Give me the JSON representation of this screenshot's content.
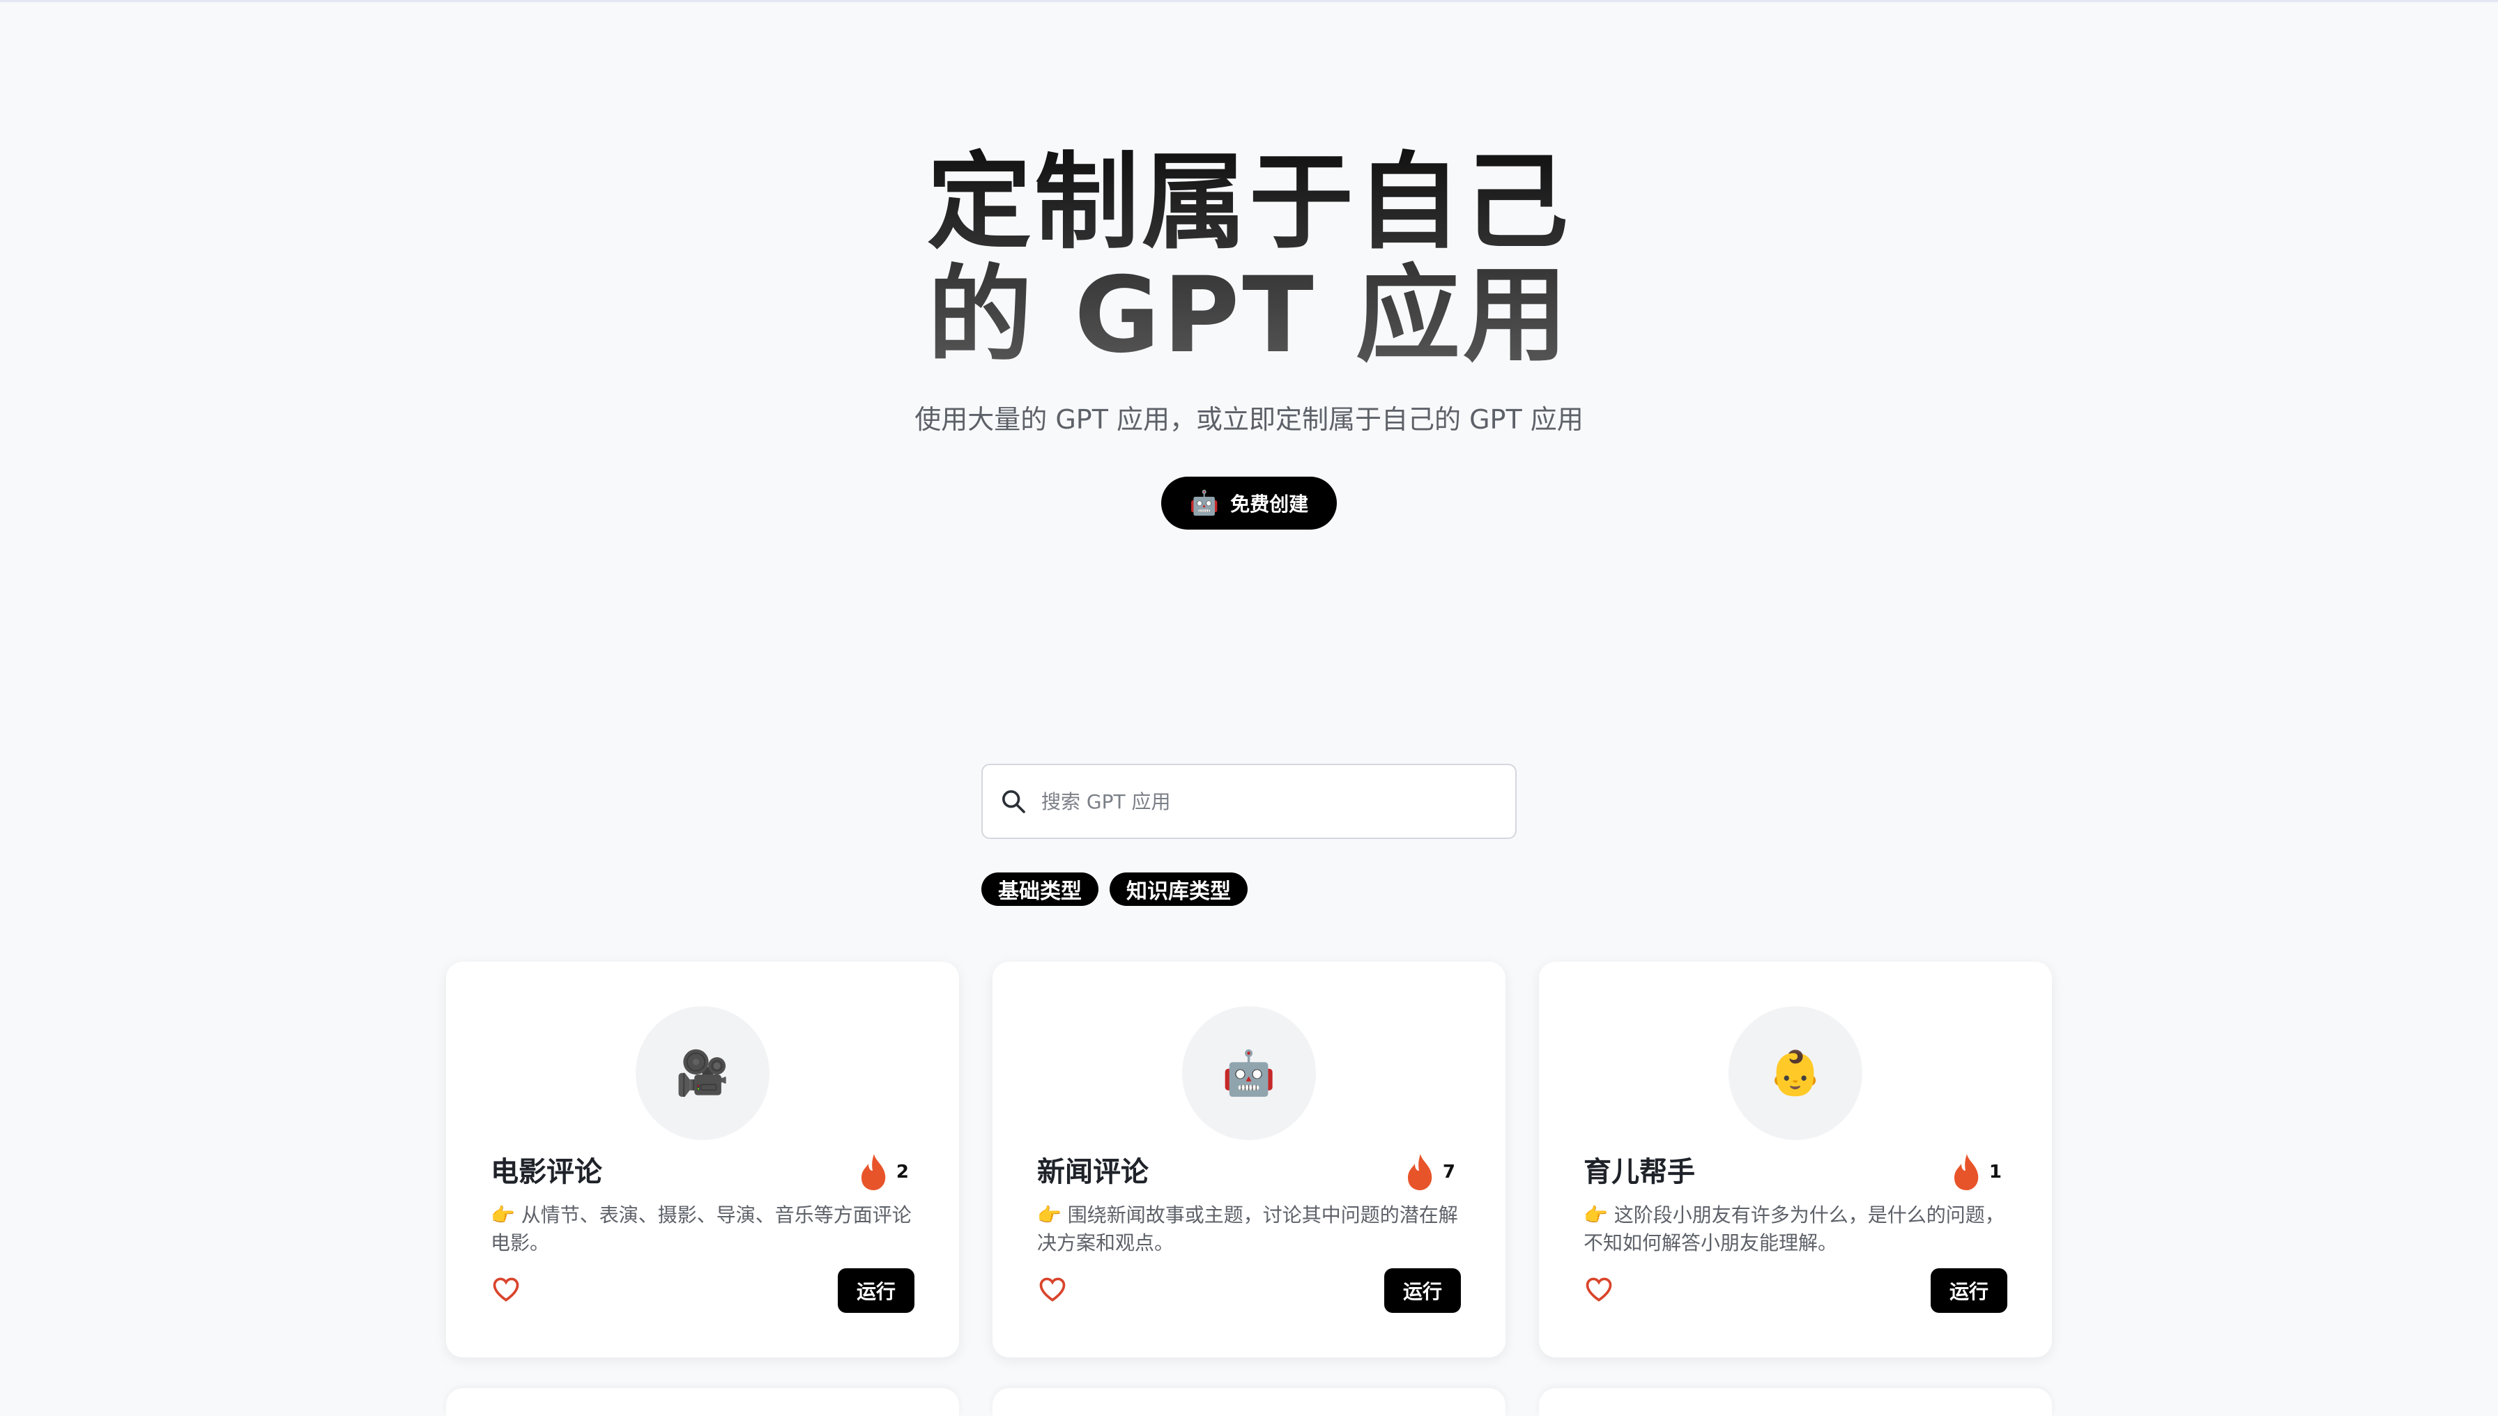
{
  "hero": {
    "title_line1": "定制属于自己",
    "title_line2": "的 GPT 应用",
    "subtitle": "使用大量的 GPT 应用，或立即定制属于自己的 GPT 应用",
    "create_button": {
      "icon": "🤖",
      "label": "免费创建"
    }
  },
  "search": {
    "placeholder": "搜索 GPT 应用",
    "value": ""
  },
  "filters": [
    {
      "label": "基础类型"
    },
    {
      "label": "知识库类型"
    }
  ],
  "cards": [
    {
      "icon": "🎥",
      "title": "电影评论",
      "hot_count": "2",
      "description": "👉 从情节、表演、摄影、导演、音乐等方面评论电影。",
      "run_label": "运行"
    },
    {
      "icon": "🤖",
      "title": "新闻评论",
      "hot_count": "7",
      "description": "👉 围绕新闻故事或主题，讨论其中问题的潜在解决方案和观点。",
      "run_label": "运行"
    },
    {
      "icon": "👶",
      "title": "育儿帮手",
      "hot_count": "1",
      "description": "👉 这阶段小朋友有许多为什么，是什么的问题，不知如何解答小朋友能理解。",
      "run_label": "运行"
    }
  ],
  "colors": {
    "background": "#f8f9fb",
    "accent_button": "#000000",
    "hot_icon": "#e8542a",
    "like_icon": "#d9442b"
  },
  "icons": {
    "search": "search-icon",
    "hot": "fire-icon",
    "like": "heart-icon"
  }
}
